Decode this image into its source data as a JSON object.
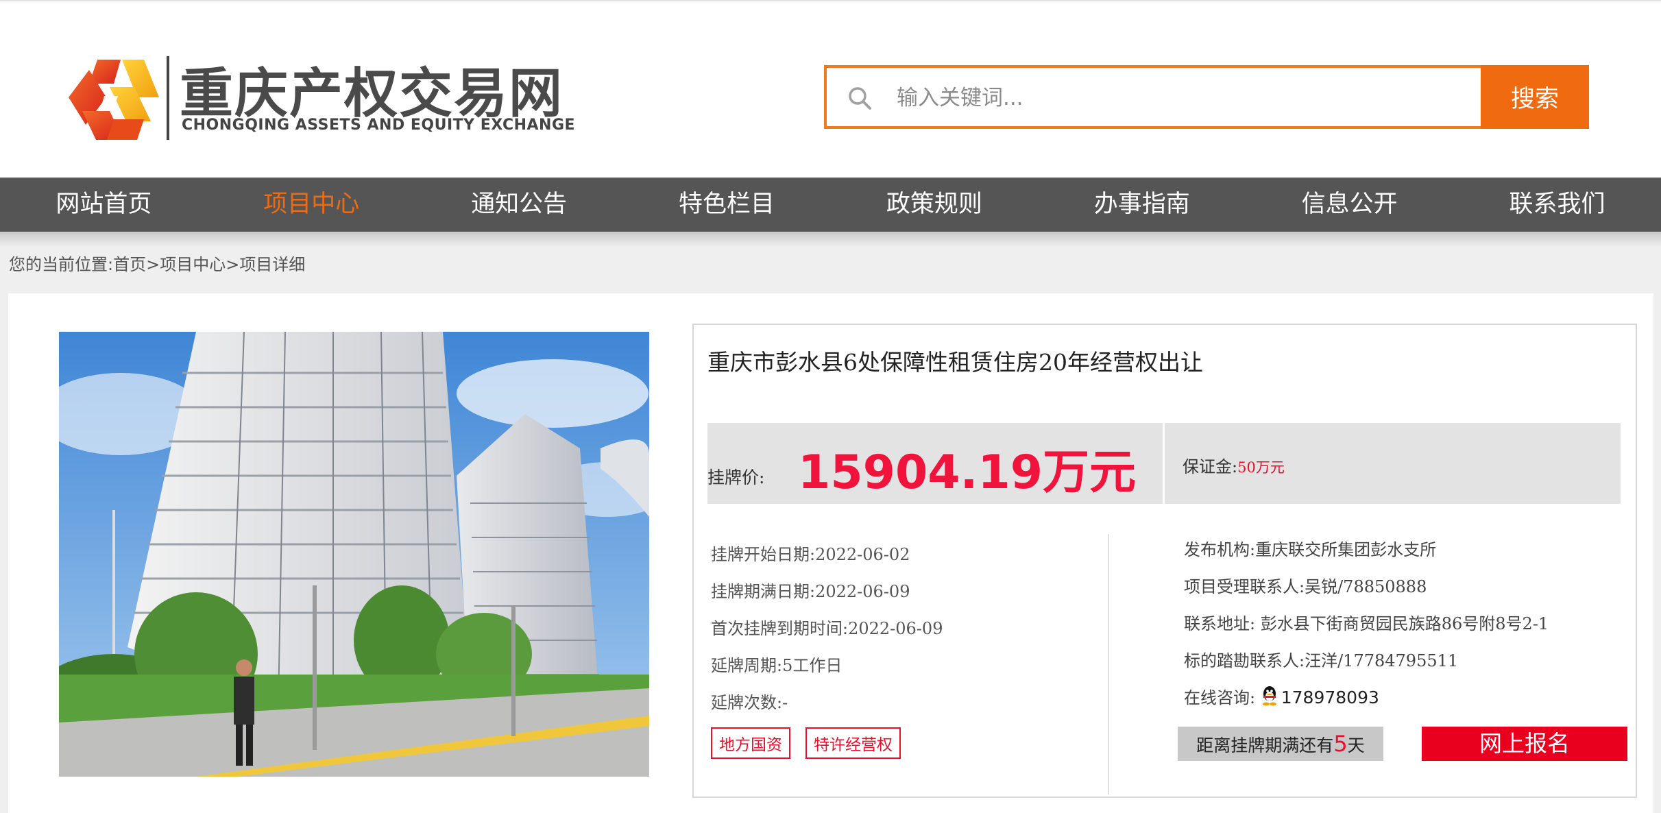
{
  "logo": {
    "name_cn": "重庆产权交易网",
    "name_en": "CHONGQING ASSETS AND EQUITY EXCHANGE"
  },
  "search": {
    "placeholder": "输入关键词...",
    "value": "",
    "button_label": "搜索"
  },
  "nav": {
    "items": [
      {
        "label": "网站首页"
      },
      {
        "label": "项目中心",
        "active": true
      },
      {
        "label": "通知公告"
      },
      {
        "label": "特色栏目"
      },
      {
        "label": "政策规则"
      },
      {
        "label": "办事指南"
      },
      {
        "label": "信息公开"
      },
      {
        "label": "联系我们"
      }
    ],
    "active_color": "#f06a10"
  },
  "breadcrumb": {
    "prefix": "您的当前位置:",
    "items": [
      "首页",
      "项目中心",
      "项目详细"
    ],
    "separator": ">"
  },
  "project": {
    "title": "重庆市彭水县6处保障性租赁住房20年经营权出让",
    "price_label": "挂牌价:",
    "price_value": "15904.19万元",
    "deposit_label": "保证金:",
    "deposit_value": "50万元",
    "details_left": [
      {
        "label": "挂牌开始日期:",
        "value": "2022-06-02"
      },
      {
        "label": "挂牌期满日期:",
        "value": "2022-06-09"
      },
      {
        "label": "首次挂牌到期时间:",
        "value": "2022-06-09"
      },
      {
        "label": "延牌周期:",
        "value": "5工作日"
      },
      {
        "label": "延牌次数:",
        "value": "-"
      }
    ],
    "details_right": [
      {
        "label": "发布机构:",
        "value": "重庆联交所集团彭水支所"
      },
      {
        "label": "项目受理联系人:",
        "value": "吴锐/78850888"
      },
      {
        "label": "联系地址:",
        "value": " 彭水县下街商贸园民族路86号附8号2-1"
      },
      {
        "label": "标的踏勘联系人:",
        "value": "汪洋/17784795511"
      }
    ],
    "consult_label": "在线咨询:",
    "consult_qq": "178978093",
    "tags": [
      "地方国资",
      "特许经营权"
    ],
    "countdown_prefix": "距离挂牌期满还有",
    "countdown_days": "5",
    "countdown_suffix": "天",
    "signup_label": "网上报名",
    "price_color": "#f0143c",
    "accent_red": "#e8102a"
  },
  "icons": {
    "search": "magnifier-icon",
    "qq": "qq-penguin-icon",
    "logo": "logo-mark"
  }
}
